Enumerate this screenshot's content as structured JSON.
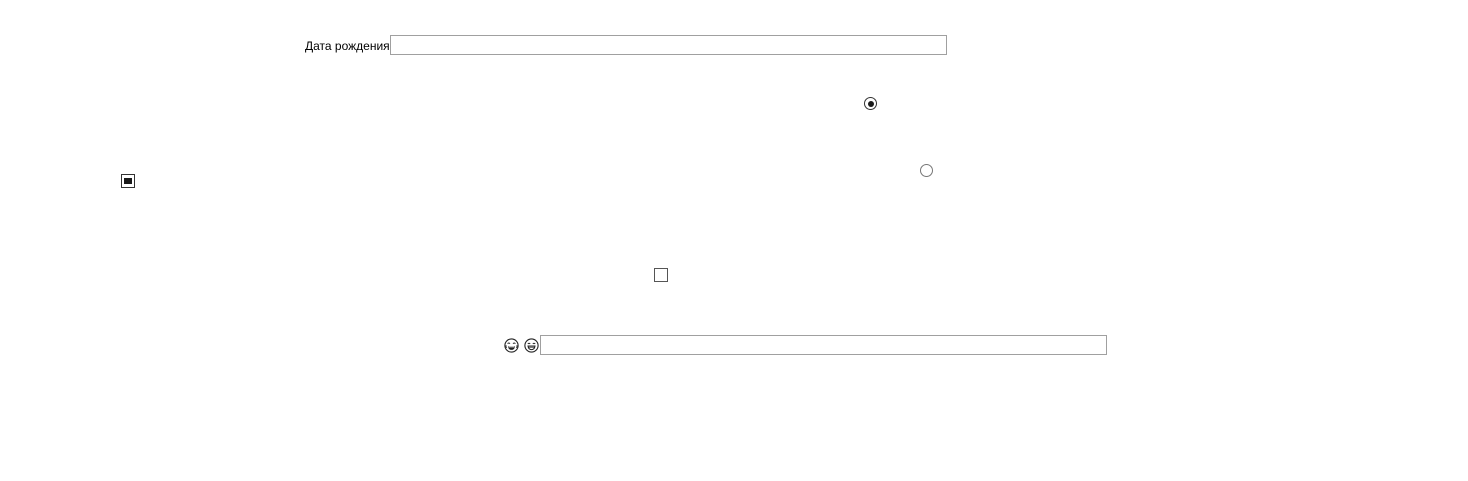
{
  "form": {
    "birth_date_label": "Дата рождения",
    "birth_date_value": "",
    "bottom_input_value": ""
  },
  "controls": {
    "radio_1": {
      "checked": true
    },
    "radio_2": {
      "checked": false
    },
    "checkbox_1": {
      "state": "indeterminate"
    },
    "checkbox_2": {
      "state": "unchecked"
    }
  },
  "icons": {
    "emoji_1": "laughing-with-tears-emoji-icon",
    "emoji_2": "grinning-face-emoji-icon"
  }
}
